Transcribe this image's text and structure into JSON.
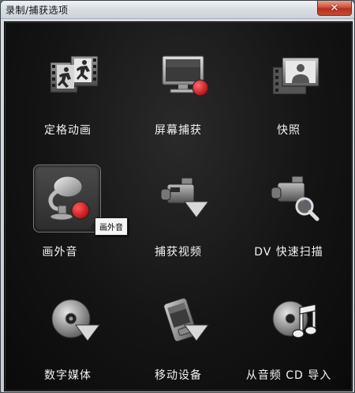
{
  "window": {
    "title": "录制/捕获选项",
    "close_glyph": "✕"
  },
  "options": [
    {
      "label": "定格动画",
      "icon": "stop-motion-icon"
    },
    {
      "label": "屏幕捕获",
      "icon": "screen-capture-icon"
    },
    {
      "label": "快照",
      "icon": "snapshot-icon"
    },
    {
      "label": "画外音",
      "icon": "voiceover-microphone-icon",
      "selected": true
    },
    {
      "label": "捕获视频",
      "icon": "capture-video-camcorder-icon"
    },
    {
      "label": "DV 快速扫描",
      "icon": "dv-quick-scan-icon"
    },
    {
      "label": "数字媒体",
      "icon": "digital-media-disc-icon"
    },
    {
      "label": "移动设备",
      "icon": "mobile-device-icon"
    },
    {
      "label": "从音频 CD 导入",
      "icon": "audio-cd-import-icon"
    }
  ],
  "tooltip": {
    "text": "画外音"
  },
  "colors": {
    "panel_bg": "#141414",
    "record_red": "#d8151b",
    "label_text": "#f2f2f2",
    "close_red": "#c94a34"
  }
}
